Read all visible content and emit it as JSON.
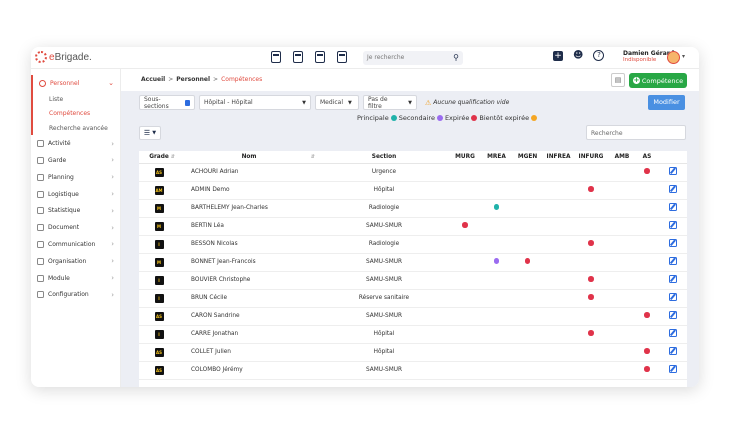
{
  "app": {
    "logo_prefix": "e",
    "logo_rest": "Brigade.",
    "search_placeholder": "Je recherche",
    "user_name": "Damien Gérard",
    "user_status": "Indisponible"
  },
  "sidebar": {
    "items": [
      {
        "label": "Personnel",
        "active": true,
        "icon": "user-icon"
      },
      {
        "label": "Activité",
        "icon": "activity-icon"
      },
      {
        "label": "Garde",
        "icon": "guard-icon"
      },
      {
        "label": "Planning",
        "icon": "planning-icon"
      },
      {
        "label": "Logistique",
        "icon": "logistics-icon"
      },
      {
        "label": "Statistique",
        "icon": "stats-icon"
      },
      {
        "label": "Document",
        "icon": "document-icon"
      },
      {
        "label": "Communication",
        "icon": "mail-icon"
      },
      {
        "label": "Organisation",
        "icon": "organisation-icon"
      },
      {
        "label": "Module",
        "icon": "module-icon"
      },
      {
        "label": "Configuration",
        "icon": "settings-icon"
      }
    ],
    "sub_items": [
      {
        "label": "Liste"
      },
      {
        "label": "Compétences",
        "active": true
      },
      {
        "label": "Recherche avancée"
      }
    ]
  },
  "breadcrumb": {
    "home": "Accueil",
    "section": "Personnel",
    "current": "Compétences",
    "separator": ">"
  },
  "toolbar": {
    "add_label": "Compétence",
    "modify_label": "Modifier"
  },
  "filters": {
    "subsections_label": "Sous-sections",
    "hospital_value": "Hôpital - Hôpital",
    "medical_value": "Medical",
    "filter_value": "Pas de filtre",
    "warning": "Aucune qualification vide",
    "search_placeholder": "Recherche"
  },
  "legend": {
    "items": [
      {
        "label": "Principale",
        "color": "#20b2aa"
      },
      {
        "label": "Secondaire",
        "color": "#9b6cf0"
      },
      {
        "label": "Expirée",
        "color": "#e0334a"
      },
      {
        "label": "Bientôt expirée",
        "color": "#f5a623"
      }
    ]
  },
  "table": {
    "headers": {
      "grade": "Grade",
      "nom": "Nom",
      "section": "Section",
      "quals": [
        "MURG",
        "MREA",
        "MGEN",
        "INFREA",
        "INFURG",
        "AMB",
        "AS"
      ]
    },
    "rows": [
      {
        "grade": "AS",
        "nom": "ACHOURI Adrian",
        "section": "Urgence",
        "marks": {
          "AS": "#e0334a"
        }
      },
      {
        "grade": "AM",
        "nom": "ADMIN Demo",
        "section": "Hôpital",
        "marks": {
          "INFURG": "#e0334a"
        }
      },
      {
        "grade": "M",
        "nom": "BARTHELEMY Jean-Charles",
        "section": "Radiologie",
        "marks": {
          "MREA": "#20b2aa"
        }
      },
      {
        "grade": "M",
        "nom": "BERTIN Léa",
        "section": "SAMU-SMUR",
        "marks": {
          "MURG": "#e0334a"
        }
      },
      {
        "grade": "I",
        "nom": "BESSON Nicolas",
        "section": "Radiologie",
        "marks": {
          "INFURG": "#e0334a"
        }
      },
      {
        "grade": "M",
        "nom": "BONNET Jean-Francois",
        "section": "SAMU-SMUR",
        "marks": {
          "MREA": "#9b6cf0",
          "MGEN": "#e0334a"
        }
      },
      {
        "grade": "I",
        "nom": "BOUVIER Christophe",
        "section": "SAMU-SMUR",
        "marks": {
          "INFURG": "#e0334a"
        }
      },
      {
        "grade": "I",
        "nom": "BRUN Cécile",
        "section": "Réserve sanitaire",
        "marks": {
          "INFURG": "#e0334a"
        }
      },
      {
        "grade": "AS",
        "nom": "CARON Sandrine",
        "section": "SAMU-SMUR",
        "marks": {
          "AS": "#e0334a"
        }
      },
      {
        "grade": "I",
        "nom": "CARRE Jonathan",
        "section": "Hôpital",
        "marks": {
          "INFURG": "#e0334a"
        }
      },
      {
        "grade": "AS",
        "nom": "COLLET Julien",
        "section": "Hôpital",
        "marks": {
          "AS": "#e0334a"
        }
      },
      {
        "grade": "AS",
        "nom": "COLOMBO Jérémy",
        "section": "SAMU-SMUR",
        "marks": {
          "AS": "#e0334a"
        }
      }
    ]
  }
}
